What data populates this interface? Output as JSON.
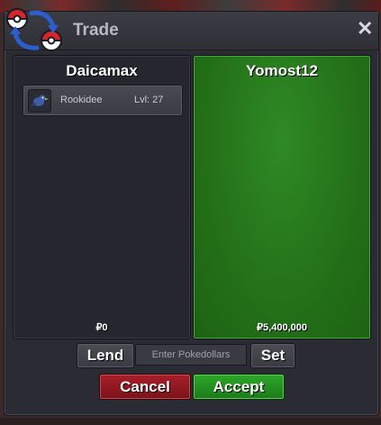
{
  "window": {
    "title": "Trade",
    "close_icon": "close-icon"
  },
  "left_panel": {
    "player_name": "Daicamax",
    "pokemon": [
      {
        "name": "Rookidee",
        "level": "Lvl: 27",
        "icon": "bird-icon"
      }
    ],
    "money": "₽0"
  },
  "right_panel": {
    "player_name": "Yomost12",
    "money": "₽5,400,000",
    "accent_color": "#237018"
  },
  "controls": {
    "lend_label": "Lend",
    "money_placeholder": "Enter Pokedollars",
    "set_label": "Set",
    "cancel_label": "Cancel",
    "accept_label": "Accept"
  },
  "colors": {
    "cancel": "#a81f2a",
    "accept": "#2ea82a"
  }
}
